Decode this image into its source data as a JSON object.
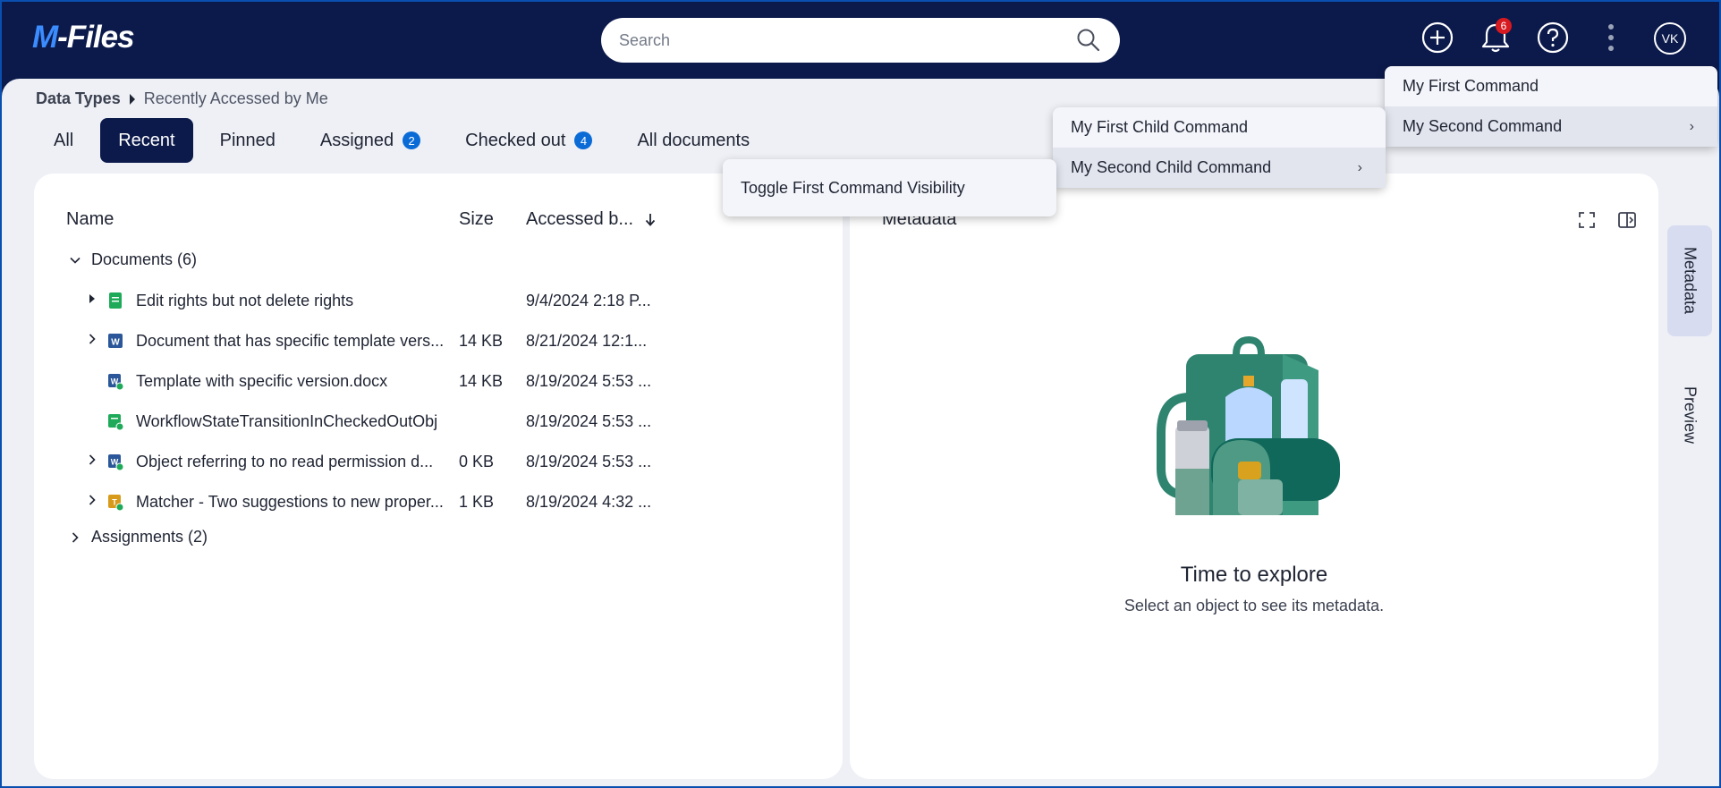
{
  "app": {
    "logo_prefix": "M",
    "logo_suffix": "-Files"
  },
  "search": {
    "placeholder": "Search"
  },
  "header_icons": {
    "add": "plus-circle-icon",
    "notifications": "bell-icon",
    "notifications_count": "6",
    "help": "question-circle-icon",
    "more": "kebab-icon",
    "avatar_initials": "VK"
  },
  "breadcrumb": {
    "root": "Data Types",
    "current": "Recently Accessed by Me"
  },
  "tabs": [
    {
      "label": "All",
      "count": null
    },
    {
      "label": "Recent",
      "count": null,
      "active": true
    },
    {
      "label": "Pinned",
      "count": null
    },
    {
      "label": "Assigned",
      "count": "2"
    },
    {
      "label": "Checked out",
      "count": "4"
    },
    {
      "label": "All documents",
      "count": null
    }
  ],
  "list": {
    "columns": {
      "name": "Name",
      "size": "Size",
      "accessed": "Accessed b..."
    },
    "sort_icon": "arrow-down-icon",
    "groups": [
      {
        "label": "Documents (6)",
        "expanded": true
      },
      {
        "label": "Assignments (2)",
        "expanded": false
      }
    ],
    "rows": [
      {
        "expander": "solid",
        "icon": "green-doc-icon",
        "name": "Edit rights but not delete rights",
        "size": "",
        "date": "9/4/2024 2:18 P..."
      },
      {
        "expander": "outline",
        "icon": "word-doc-icon",
        "name": "Document that has specific template vers...",
        "size": "14 KB",
        "date": "8/21/2024 12:1..."
      },
      {
        "expander": "none",
        "icon": "word-doc-check-icon",
        "name": "Template with specific version.docx",
        "size": "14 KB",
        "date": "8/19/2024 5:53 ..."
      },
      {
        "expander": "none",
        "icon": "green-doc-check-icon",
        "name": "WorkflowStateTransitionInCheckedOutObj",
        "size": "",
        "date": "8/19/2024 5:53 ..."
      },
      {
        "expander": "outline",
        "icon": "word-doc-check-icon",
        "name": "Object referring to no read permission d...",
        "size": "0 KB",
        "date": "8/19/2024 5:53 ..."
      },
      {
        "expander": "outline",
        "icon": "orange-doc-check-icon",
        "name": "Matcher - Two suggestions to new proper...",
        "size": "1 KB",
        "date": "8/19/2024 4:32 ..."
      }
    ]
  },
  "metadata": {
    "title": "Metadata",
    "empty_title": "Time to explore",
    "empty_subtitle": "Select an object to see its metadata."
  },
  "rail": {
    "metadata": "Metadata",
    "preview": "Preview"
  },
  "menus": {
    "main": [
      "My First Command",
      "My Second Command"
    ],
    "child": [
      "My First Child Command",
      "My Second Child Command"
    ],
    "grandchild": [
      "Toggle First Command Visibility"
    ]
  },
  "colors": {
    "navy": "#0c1a4b",
    "accent": "#0a6bd6",
    "badge": "#d71920",
    "teal": "#2f8470"
  }
}
